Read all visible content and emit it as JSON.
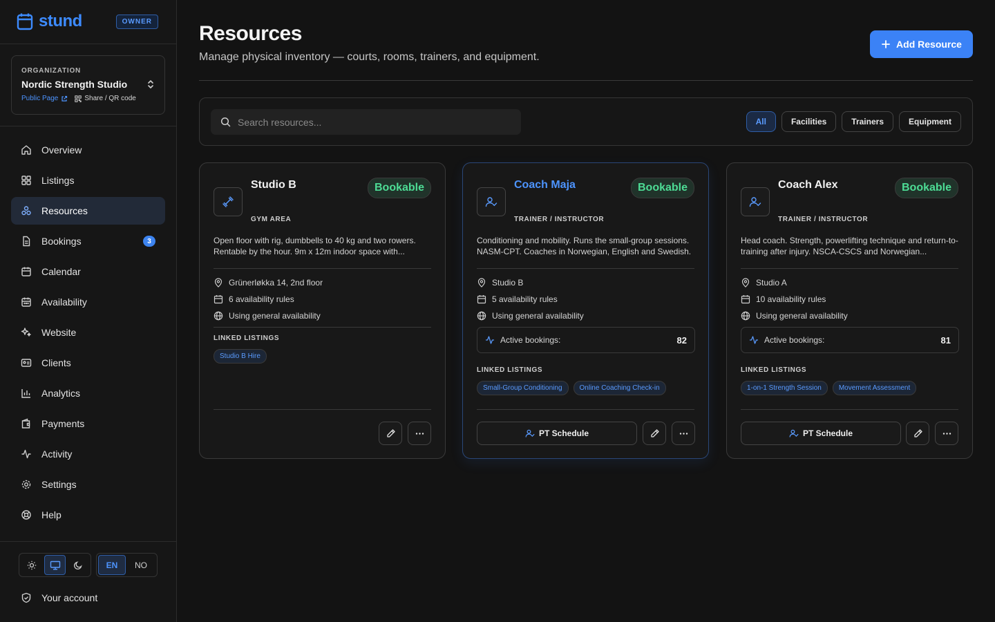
{
  "brand": {
    "name": "stund",
    "role_badge": "OWNER"
  },
  "org": {
    "label": "ORGANIZATION",
    "name": "Nordic Strength Studio",
    "public_link": "Public Page",
    "share_link": "Share / QR code"
  },
  "nav": [
    {
      "label": "Overview",
      "icon": "home-icon",
      "active": false
    },
    {
      "label": "Listings",
      "icon": "grid-icon",
      "active": false
    },
    {
      "label": "Resources",
      "icon": "boxes-icon",
      "active": true
    },
    {
      "label": "Bookings",
      "icon": "file-icon",
      "active": false,
      "badge": "3"
    },
    {
      "label": "Calendar",
      "icon": "calendar-icon",
      "active": false
    },
    {
      "label": "Availability",
      "icon": "calendar-days-icon",
      "active": false
    },
    {
      "label": "Website",
      "icon": "sparkles-icon",
      "active": false
    },
    {
      "label": "Clients",
      "icon": "id-card-icon",
      "active": false
    },
    {
      "label": "Analytics",
      "icon": "bar-chart-icon",
      "active": false
    },
    {
      "label": "Payments",
      "icon": "wallet-icon",
      "active": false
    },
    {
      "label": "Activity",
      "icon": "activity-icon",
      "active": false
    },
    {
      "label": "Settings",
      "icon": "gear-icon",
      "active": false
    },
    {
      "label": "Help",
      "icon": "life-buoy-icon",
      "active": false
    }
  ],
  "theme": {
    "options": [
      "sun-icon",
      "monitor-icon",
      "moon-icon"
    ],
    "selected": "monitor-icon"
  },
  "language": {
    "options": [
      "EN",
      "NO"
    ],
    "selected": "EN"
  },
  "account": {
    "label": "Your account"
  },
  "header": {
    "title": "Resources",
    "subtitle": "Manage physical inventory — courts, rooms, trainers, and equipment.",
    "add_button": "Add Resource"
  },
  "filters": {
    "search_placeholder": "Search resources...",
    "search_value": "",
    "chips": [
      "All",
      "Facilities",
      "Trainers",
      "Equipment"
    ],
    "selected": "All"
  },
  "colors": {
    "accent": "#3b82f6",
    "bookable_text": "#4ddc95",
    "bookable_bg": "#20332a"
  },
  "cards": [
    {
      "title": "Studio B",
      "type": "GYM AREA",
      "status": "Bookable",
      "description": "Open floor with rig, dumbbells to 40 kg and two rowers. Rentable by the hour. 9m x 12m indoor space with...",
      "location": "Grünerløkka 14, 2nd floor",
      "rules": "6 availability rules",
      "availability": "Using general availability",
      "active_label": "",
      "active_count": "",
      "linked_label": "LINKED LISTINGS",
      "listings": [
        "Studio B Hire"
      ],
      "pt_label": ""
    },
    {
      "title": "Coach Maja",
      "type": "TRAINER / INSTRUCTOR",
      "status": "Bookable",
      "description": "Conditioning and mobility. Runs the small-group sessions. NASM-CPT. Coaches in Norwegian, English and Swedish.",
      "location": "Studio B",
      "rules": "5 availability rules",
      "availability": "Using general availability",
      "active_label": "Active bookings:",
      "active_count": "82",
      "linked_label": "LINKED LISTINGS",
      "listings": [
        "Small-Group Conditioning",
        "Online Coaching Check-in"
      ],
      "pt_label": "PT Schedule"
    },
    {
      "title": "Coach Alex",
      "type": "TRAINER / INSTRUCTOR",
      "status": "Bookable",
      "description": "Head coach. Strength, powerlifting technique and return-to-training after injury. NSCA-CSCS and Norwegian...",
      "location": "Studio A",
      "rules": "10 availability rules",
      "availability": "Using general availability",
      "active_label": "Active bookings:",
      "active_count": "81",
      "linked_label": "LINKED LISTINGS",
      "listings": [
        "1-on-1 Strength Session",
        "Movement Assessment"
      ],
      "pt_label": "PT Schedule"
    }
  ]
}
